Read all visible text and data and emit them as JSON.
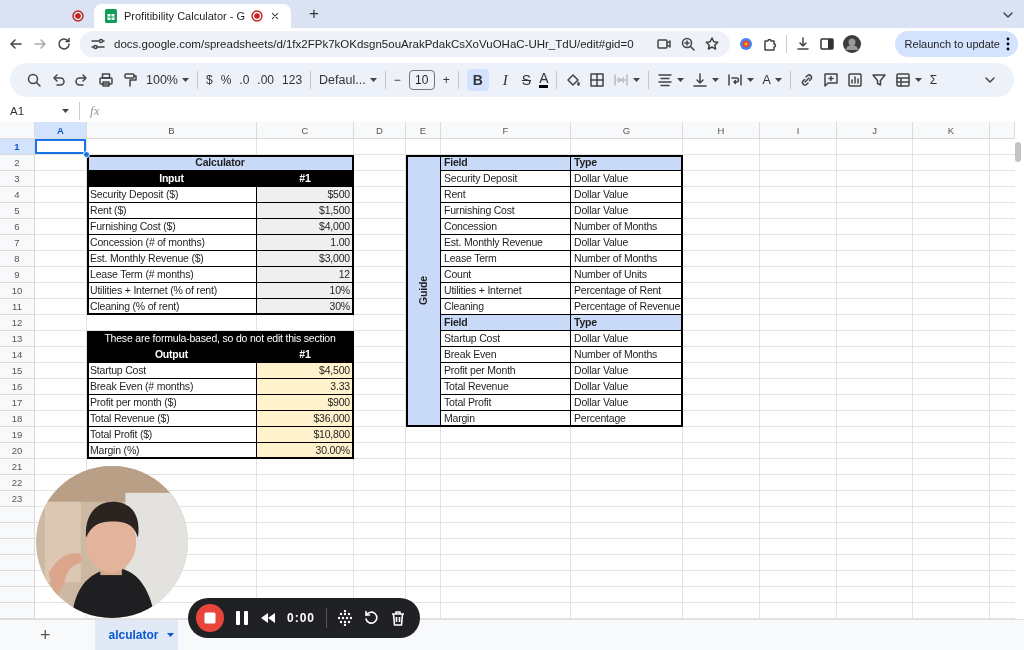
{
  "browser": {
    "tabs": [
      {
        "selected": false,
        "recording": true
      },
      {
        "title": "Profitibility Calculator - G",
        "selected": true,
        "recording": true
      }
    ],
    "new_tab": "+",
    "url": "docs.google.com/spreadsheets/d/1fx2FPk7kOKdsgn5ouArakPdakCsXoVuOHaC-UHr_TdU/edit#gid=0",
    "update_button": "Relaunch to update"
  },
  "toolbar": [
    {
      "kind": "icon"
    },
    {
      "kind": "icon"
    },
    {
      "kind": "icon"
    },
    {
      "kind": "icon"
    },
    {
      "kind": "icon"
    },
    {
      "kind": "menu",
      "label": "100%"
    },
    {
      "kind": "sep"
    },
    {
      "kind": "text",
      "label": "$"
    },
    {
      "kind": "text",
      "label": "%"
    },
    {
      "kind": "text",
      "label": ".0"
    },
    {
      "kind": "text",
      "label": ".00"
    },
    {
      "kind": "text",
      "label": "123"
    },
    {
      "kind": "sep"
    },
    {
      "kind": "menu",
      "label": "Defaul..."
    },
    {
      "kind": "sep"
    },
    {
      "kind": "text",
      "label": "−"
    },
    {
      "kind": "field",
      "label": "10"
    },
    {
      "kind": "text",
      "label": "+"
    },
    {
      "kind": "sep"
    },
    {
      "kind": "toggle",
      "label": "B",
      "selected": true
    },
    {
      "kind": "toggle",
      "label": "I",
      "selected": false
    },
    {
      "kind": "strike",
      "label": "S"
    },
    {
      "kind": "color",
      "label": "A"
    },
    {
      "kind": "sep"
    },
    {
      "kind": "icon"
    },
    {
      "kind": "icon"
    },
    {
      "kind": "icon_menu",
      "disabled": true
    },
    {
      "kind": "sep"
    },
    {
      "kind": "icon_menu",
      "disabled": false
    },
    {
      "kind": "icon_menu",
      "disabled": false
    },
    {
      "kind": "icon_menu",
      "disabled": false
    },
    {
      "kind": "menu",
      "label": "A"
    },
    {
      "kind": "sep"
    },
    {
      "kind": "icon"
    },
    {
      "kind": "icon"
    },
    {
      "kind": "icon"
    },
    {
      "kind": "icon"
    },
    {
      "kind": "icon_menu",
      "disabled": false
    },
    {
      "kind": "text",
      "label": "Σ"
    },
    {
      "kind": "icon"
    }
  ],
  "formula_bar": {
    "name_box": "A1",
    "fx": "fx"
  },
  "sheet": {
    "columns": [
      {
        "label": "A",
        "selected": true
      },
      {
        "label": "B",
        "selected": false
      },
      {
        "label": "C",
        "selected": false
      },
      {
        "label": "D",
        "selected": false
      },
      {
        "label": "E",
        "selected": false
      },
      {
        "label": "F",
        "selected": false
      },
      {
        "label": "G",
        "selected": false
      },
      {
        "label": "H",
        "selected": false
      },
      {
        "label": "I",
        "selected": false
      },
      {
        "label": "J",
        "selected": false
      },
      {
        "label": "K",
        "selected": false
      }
    ],
    "rows": [
      {
        "label": "1",
        "selected": true
      },
      {
        "label": "2",
        "selected": false
      },
      {
        "label": "3",
        "selected": false
      },
      {
        "label": "4",
        "selected": false
      },
      {
        "label": "5",
        "selected": false
      },
      {
        "label": "6",
        "selected": false
      },
      {
        "label": "7",
        "selected": false
      },
      {
        "label": "8",
        "selected": false
      },
      {
        "label": "9",
        "selected": false
      },
      {
        "label": "10",
        "selected": false
      },
      {
        "label": "11",
        "selected": false
      },
      {
        "label": "12",
        "selected": false
      },
      {
        "label": "13",
        "selected": false
      },
      {
        "label": "14",
        "selected": false
      },
      {
        "label": "15",
        "selected": false
      },
      {
        "label": "16",
        "selected": false
      },
      {
        "label": "17",
        "selected": false
      },
      {
        "label": "18",
        "selected": false
      },
      {
        "label": "19",
        "selected": false
      },
      {
        "label": "20",
        "selected": false
      },
      {
        "label": "21",
        "selected": false
      },
      {
        "label": "22",
        "selected": false
      },
      {
        "label": "23",
        "selected": false
      }
    ],
    "calculator": {
      "title": "Calculator",
      "input_header": [
        "Input",
        "#1"
      ],
      "inputs": [
        [
          "Security Deposit ($)",
          "$500"
        ],
        [
          "Rent ($)",
          "$1,500"
        ],
        [
          "Furnishing Cost ($)",
          "$4,000"
        ],
        [
          "Concession (# of months)",
          "1.00"
        ],
        [
          "Est. Monthly Revenue ($)",
          "$3,000"
        ],
        [
          "Lease Term (# months)",
          "12"
        ],
        [
          "Utilities + Internet (% of rent)",
          "10%"
        ],
        [
          "Cleaning (% of rent)",
          "30%"
        ]
      ],
      "note": "These are formula-based, so do not edit this section",
      "output_header": [
        "Output",
        "#1"
      ],
      "outputs": [
        [
          "Startup Cost",
          "$4,500"
        ],
        [
          "Break Even (# months)",
          "3.33"
        ],
        [
          "Profit per month ($)",
          "$900"
        ],
        [
          "Total Revenue ($)",
          "$36,000"
        ],
        [
          "Total Profit ($)",
          "$10,800"
        ],
        [
          "Margin (%)",
          "30.00%"
        ]
      ]
    },
    "guide": {
      "label": "Guide",
      "sections": [
        {
          "header": [
            "Field",
            "Type"
          ],
          "rows": [
            [
              "Security Deposit",
              "Dollar Value"
            ],
            [
              "Rent",
              "Dollar Value"
            ],
            [
              "Furnishing Cost",
              "Dollar Value"
            ],
            [
              "Concession",
              "Number of Months"
            ],
            [
              "Est. Monthly Revenue",
              "Dollar Value"
            ],
            [
              "Lease Term",
              "Number of Months"
            ],
            [
              "Count",
              "Number of Units"
            ],
            [
              "Utilities + Internet",
              "Percentage of Rent"
            ],
            [
              "Cleaning",
              "Percentage of Revenue"
            ]
          ]
        },
        {
          "header": [
            "Field",
            "Type"
          ],
          "rows": [
            [
              "Startup Cost",
              "Dollar Value"
            ],
            [
              "Break Even",
              "Number of Months"
            ],
            [
              "Profit per Month",
              "Dollar Value"
            ],
            [
              "Total Revenue",
              "Dollar Value"
            ],
            [
              "Total Profit",
              "Dollar Value"
            ],
            [
              "Margin",
              "Percentage"
            ]
          ]
        }
      ]
    }
  },
  "sheet_tabs": {
    "add": "+",
    "tabs": [
      {
        "label": "alculator",
        "selected": true
      }
    ]
  },
  "recorder": {
    "time": "0:00"
  }
}
